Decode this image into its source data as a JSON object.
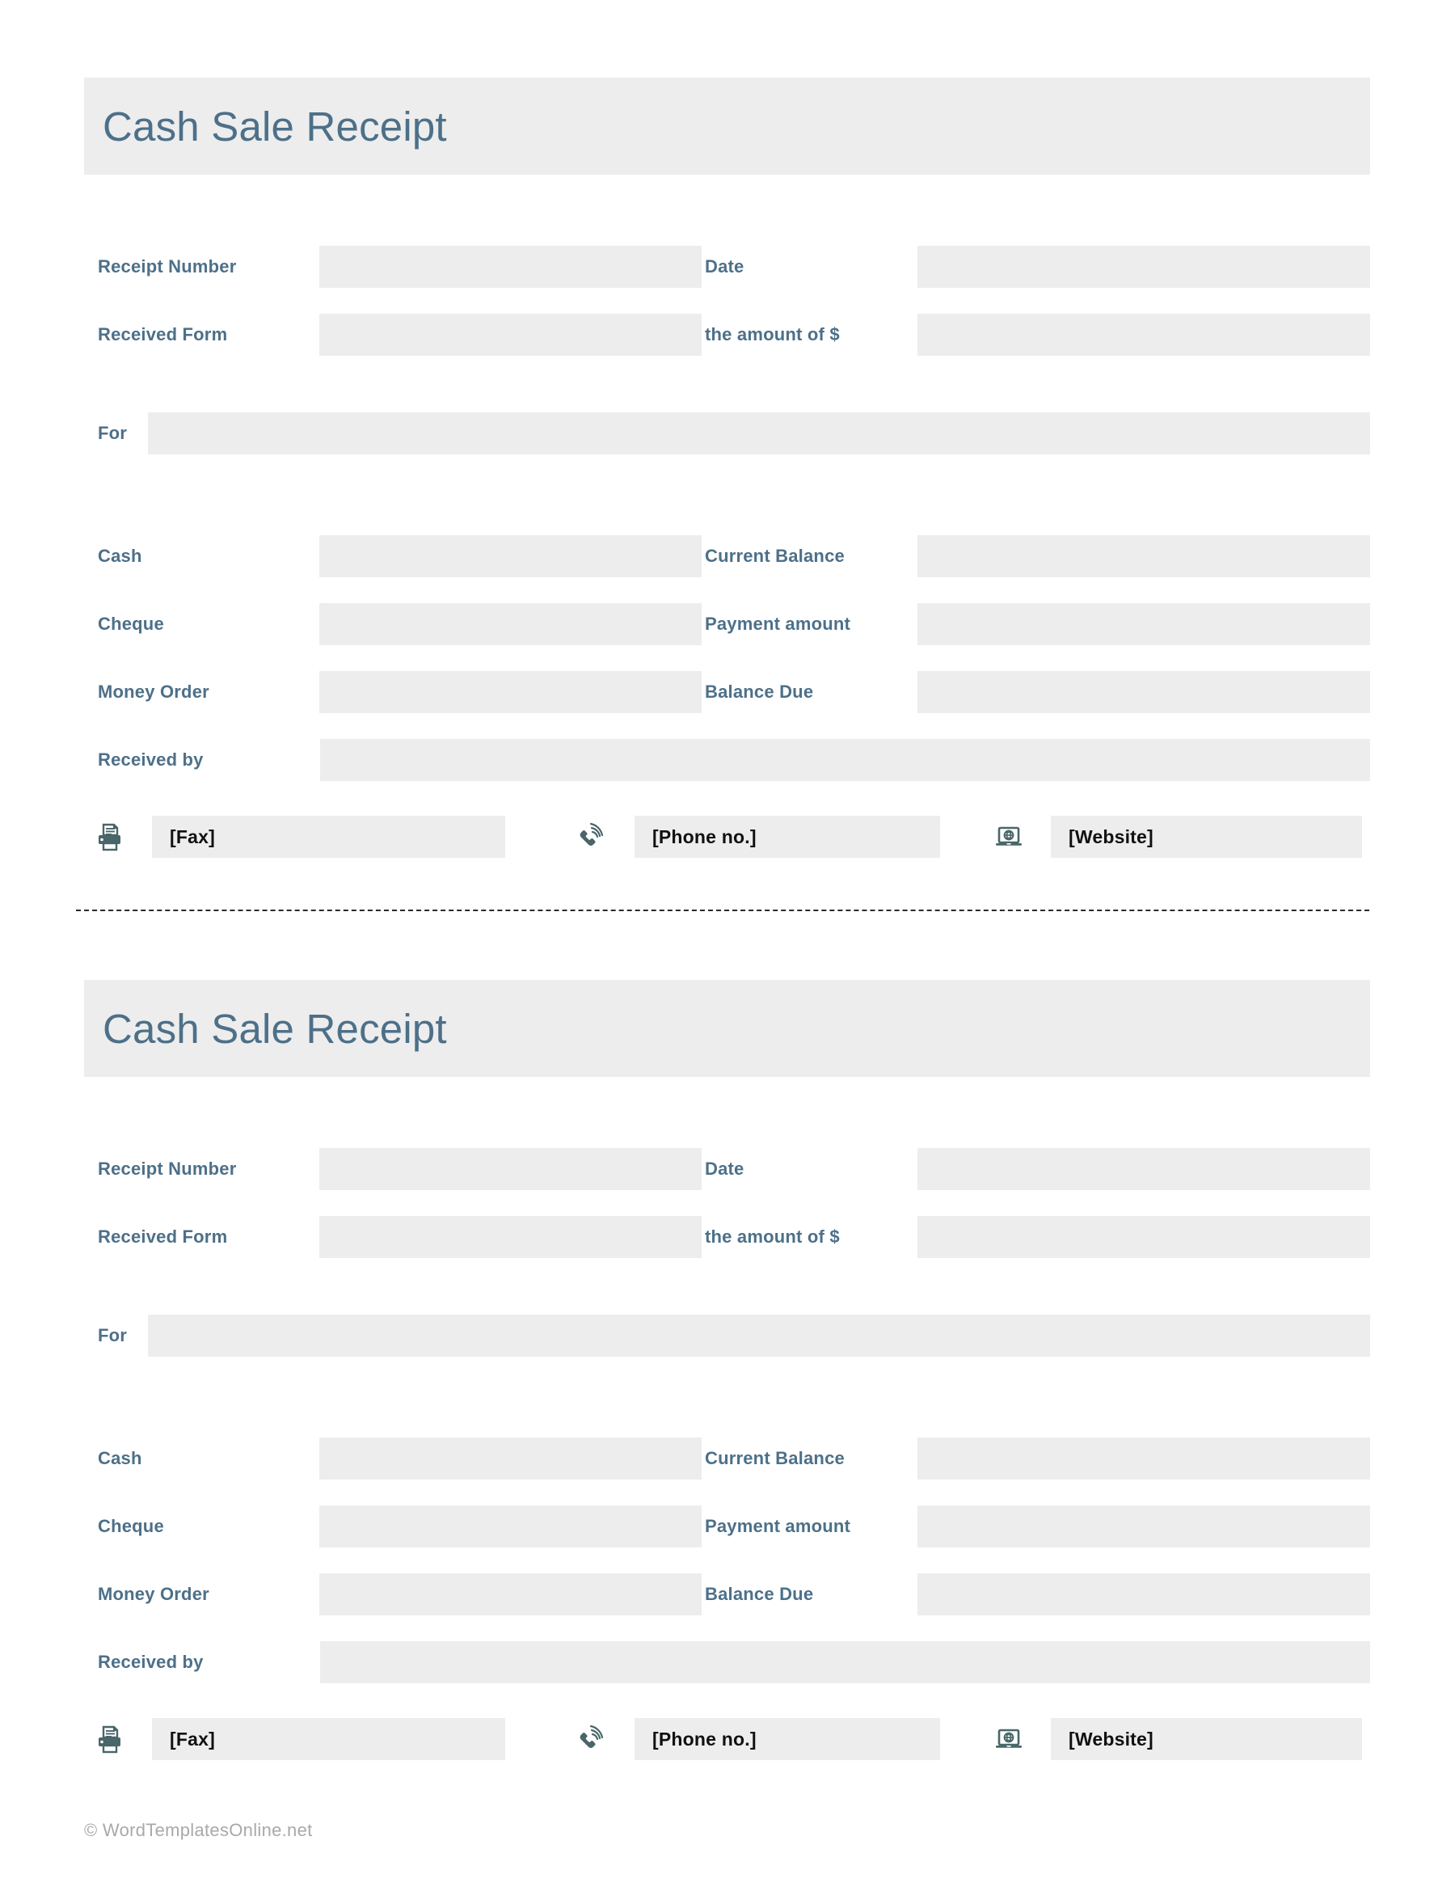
{
  "document": {
    "copyright": "© WordTemplatesOnline.net"
  },
  "colors": {
    "label_blue": "#4d7089",
    "field_gray": "#ededed",
    "banner_gray": "#ededed",
    "icon_teal": "#49666a",
    "copyright_gray": "#a9a9a9",
    "separator": "#2b2b2b"
  },
  "receipts": [
    {
      "title": "Cash Sale Receipt",
      "fields": {
        "receipt_number_label": "Receipt Number",
        "receipt_number_value": "",
        "date_label": "Date",
        "date_value": "",
        "received_form_label": "Received Form",
        "received_form_value": "",
        "amount_label": "the amount of $",
        "amount_value": "",
        "for_label": "For",
        "for_value": "",
        "cash_label": "Cash",
        "cash_value": "",
        "current_balance_label": "Current Balance",
        "current_balance_value": "",
        "cheque_label": "Cheque",
        "cheque_value": "",
        "payment_amount_label": "Payment amount",
        "payment_amount_value": "",
        "money_order_label": "Money Order",
        "money_order_value": "",
        "balance_due_label": "Balance Due",
        "balance_due_value": "",
        "received_by_label": "Received by",
        "received_by_value": ""
      },
      "contact": {
        "fax_icon": "fax-printer-icon",
        "fax_value": "[Fax]",
        "phone_icon": "ringing-phone-icon",
        "phone_value": "[Phone no.]",
        "website_icon": "laptop-globe-icon",
        "website_value": "[Website]"
      }
    },
    {
      "title": "Cash Sale Receipt",
      "fields": {
        "receipt_number_label": "Receipt Number",
        "receipt_number_value": "",
        "date_label": "Date",
        "date_value": "",
        "received_form_label": "Received Form",
        "received_form_value": "",
        "amount_label": "the amount of $",
        "amount_value": "",
        "for_label": "For",
        "for_value": "",
        "cash_label": "Cash",
        "cash_value": "",
        "current_balance_label": "Current Balance",
        "current_balance_value": "",
        "cheque_label": "Cheque",
        "cheque_value": "",
        "payment_amount_label": "Payment amount",
        "payment_amount_value": "",
        "money_order_label": "Money Order",
        "money_order_value": "",
        "balance_due_label": "Balance Due",
        "balance_due_value": "",
        "received_by_label": "Received by",
        "received_by_value": ""
      },
      "contact": {
        "fax_icon": "fax-printer-icon",
        "fax_value": "[Fax]",
        "phone_icon": "ringing-phone-icon",
        "phone_value": "[Phone no.]",
        "website_icon": "laptop-globe-icon",
        "website_value": "[Website]"
      }
    }
  ]
}
